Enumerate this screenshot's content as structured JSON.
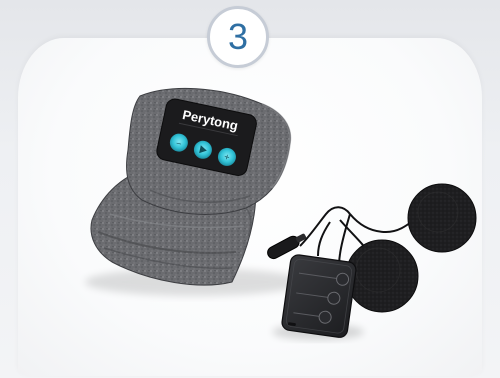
{
  "step": {
    "number": "3"
  },
  "product": {
    "brand_label": "Perytong"
  },
  "colors": {
    "step_number": "#2f6fa3",
    "step_ring": "#c6ccd6",
    "button_glow": "#33c4d8",
    "fabric": "#6d6e72"
  }
}
